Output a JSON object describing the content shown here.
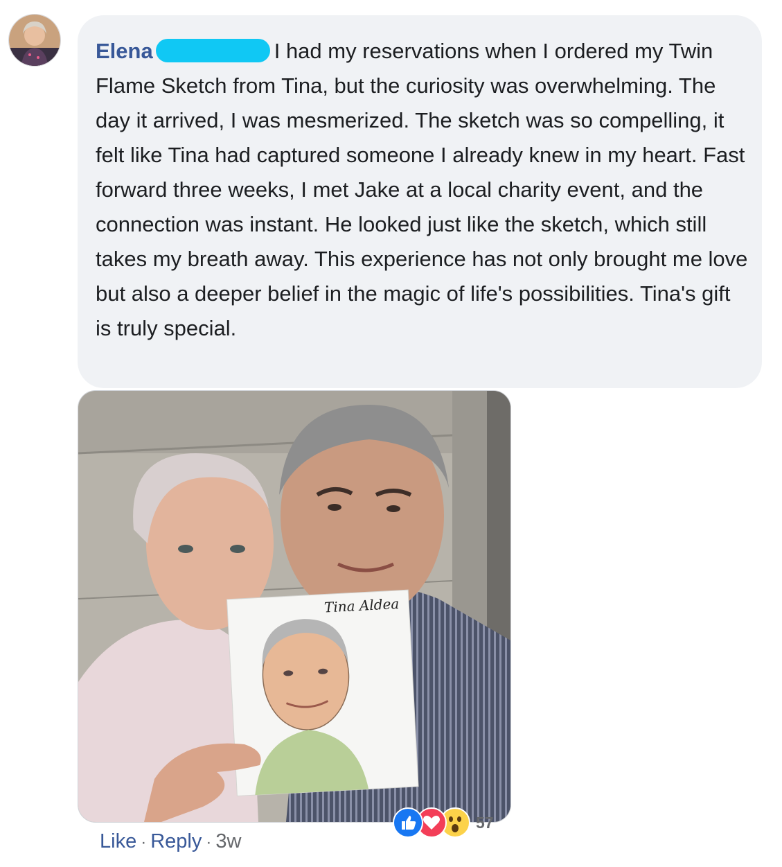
{
  "comment": {
    "author": "Elena",
    "text_line1": "I had my reservations when I ordered my",
    "text_rest": "Twin Flame Sketch from Tina, but the curiosity was overwhelming. The day it arrived, I was mesmerized. The sketch was so compelling, it felt like Tina had captured someone I already knew in my heart. Fast forward three weeks, I met Jake at a local charity event, and the connection was instant. He looked just like the sketch, which still takes my breath away. This experience has not only brought me love but also a deeper belief in the magic of life's possibilities. Tina's gift is truly special.",
    "photo_signature": "Tina Aldea"
  },
  "reactions": {
    "icons": [
      "like-icon",
      "love-icon",
      "wow-icon"
    ],
    "count": "57"
  },
  "actions": {
    "like_label": "Like",
    "reply_label": "Reply",
    "separator": "·",
    "timestamp": "3w"
  },
  "colors": {
    "author": "#385898",
    "bubble_bg": "#f0f2f5",
    "redaction": "#10c8f4",
    "like": "#1877f2",
    "love": "#f33e58",
    "wow": "#fcd24a"
  }
}
